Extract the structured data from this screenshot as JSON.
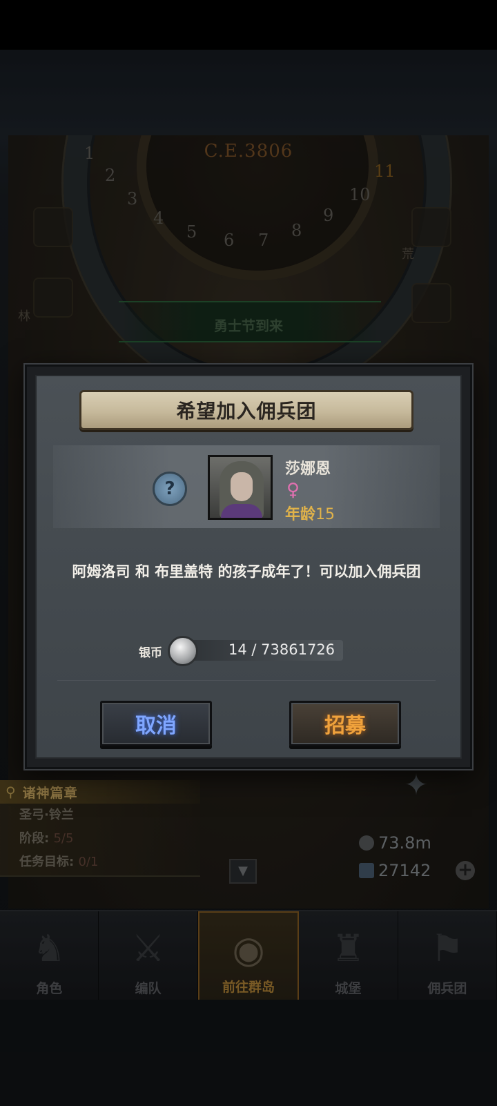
{
  "background": {
    "era_label": "C.E.3806",
    "dial_numbers": [
      "1",
      "2",
      "3",
      "4",
      "5",
      "6",
      "7",
      "8",
      "9",
      "10",
      "11"
    ],
    "event_banner": "勇士节到来",
    "side_labels": [
      "荒",
      "林"
    ]
  },
  "dialog": {
    "title": "希望加入佣兵团",
    "help_icon": "?",
    "character": {
      "name": "莎娜恩",
      "gender_icon": "female-icon",
      "age_label": "年龄",
      "age_value": "15"
    },
    "message": "阿姆洛司 和 布里盖特 的孩子成年了！可以加入佣兵团",
    "cost": {
      "label": "银币",
      "value": "14 / 73861726"
    },
    "cancel_label": "取消",
    "recruit_label": "招募"
  },
  "quest": {
    "title": "诸神篇章",
    "name": "圣弓·铃兰",
    "stage_label": "阶段:",
    "stage_value": "5/5",
    "goal_label": "任务目标:",
    "goal_value": "0/1"
  },
  "resources": {
    "silver": "73.8m",
    "crystal": "27142"
  },
  "nav": [
    {
      "label": "角色",
      "icon": "knight-icon"
    },
    {
      "label": "编队",
      "icon": "formation-icon"
    },
    {
      "label": "前往群岛",
      "icon": "globe-icon"
    },
    {
      "label": "城堡",
      "icon": "castle-icon"
    },
    {
      "label": "佣兵团",
      "icon": "mercenary-icon"
    }
  ],
  "colors": {
    "cancel_text": "#7fa6ff",
    "recruit_text": "#f0a23c",
    "age_accent": "#e0b24a",
    "gender_female": "#e070b0"
  }
}
